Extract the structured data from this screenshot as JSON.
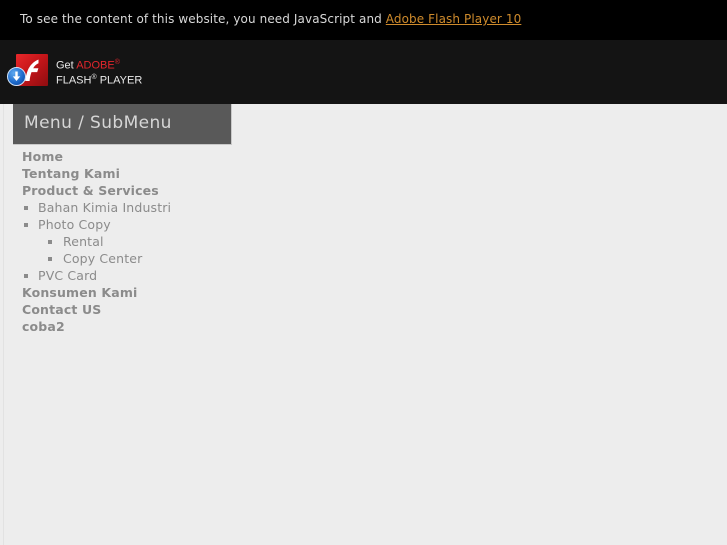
{
  "notice": {
    "text_before": "To see the content of this website, you need JavaScript and ",
    "link_label": "Adobe Flash Player 10",
    "link_color": "#cf8b2c",
    "bar_color": "#000000"
  },
  "flash_badge": {
    "icon_name": "adobe-flash-player-logo",
    "download_icon_name": "download-arrow-icon",
    "line1_get": "Get ",
    "line1_brand": "ADOBE",
    "line1_sup": "®",
    "line2_flash": "FLASH",
    "line2_sup": "®",
    "line2_player": " PLAYER",
    "brand_color": "#e3262c",
    "band_color": "#141414"
  },
  "menu_panel": {
    "header_title": "Menu / SubMenu",
    "header_bg": "#595959",
    "header_text_color": "#d6d6d6",
    "items": [
      {
        "label": "Home",
        "level": 1
      },
      {
        "label": "Tentang Kami",
        "level": 1
      },
      {
        "label": "Product & Services",
        "level": 1
      },
      {
        "label": "Bahan Kimia Industri",
        "level": 2
      },
      {
        "label": "Photo Copy",
        "level": 2
      },
      {
        "label": "Rental",
        "level": 3
      },
      {
        "label": "Copy Center",
        "level": 3
      },
      {
        "label": "PVC Card",
        "level": 2
      },
      {
        "label": "Konsumen Kami",
        "level": 1
      },
      {
        "label": "Contact US",
        "level": 1
      },
      {
        "label": "coba2",
        "level": 1
      }
    ]
  },
  "page": {
    "background": "#ededed",
    "text_color": "#8b8b8b"
  }
}
